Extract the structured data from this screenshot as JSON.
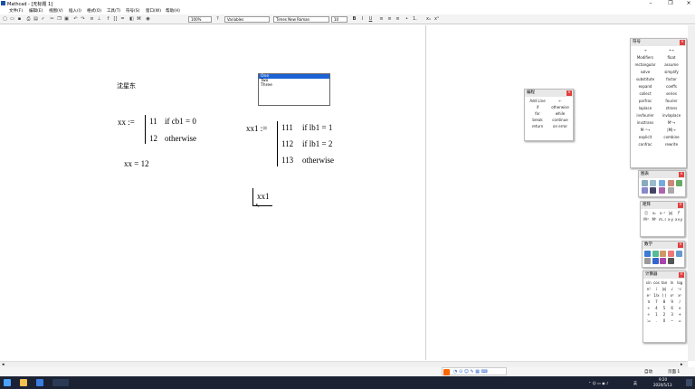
{
  "window": {
    "title": "Mathcad - [无标题 1]"
  },
  "menu": [
    "文件(F)",
    "编辑(E)",
    "视图(V)",
    "插入(I)",
    "格式(O)",
    "工具(T)",
    "符号(S)",
    "窗口(W)",
    "帮助(H)"
  ],
  "toolbar": {
    "zoom": "100%",
    "style": "Variables",
    "font": "Times New Roman",
    "size": "10",
    "bold": "B",
    "italic": "I",
    "underline": "U"
  },
  "worksheet": {
    "label_text": "沈星东",
    "xx_def": {
      "name": "xx :=",
      "row1_val": "11",
      "row1_cond": "if  cb1 = 0",
      "row2_val": "12",
      "row2_cond": "otherwise"
    },
    "xx_result": "xx = 12",
    "xx1_def": {
      "name": "xx1 :=",
      "row1_val": "111",
      "row1_cond": "if  lb1 = 1",
      "row2_val": "112",
      "row2_cond": "if  lb1 = 2",
      "row3_val": "113",
      "row3_cond": "otherwise"
    },
    "xx1_input": "xx1",
    "listbox": [
      "One",
      "Two",
      "Three"
    ]
  },
  "palettes": {
    "programming": {
      "title": "编程",
      "items": [
        "Add Line",
        "←",
        "if",
        "otherwise",
        "for",
        "while",
        "break",
        "continue",
        "return",
        "on error"
      ]
    },
    "symbolic": {
      "title": "符号",
      "items": [
        "→",
        "•→",
        "Modifiers",
        "float",
        "rectangular",
        "assume",
        "solve",
        "simplify",
        "substitute",
        "factor",
        "expand",
        "coeffs",
        "collect",
        "series",
        "parfrac",
        "fourier",
        "laplace",
        "ztrans",
        "invfourier",
        "invlaplace",
        "invztrans",
        "Mᵀ→",
        "M⁻¹→",
        "|M|→",
        "explicit",
        "combine",
        "confrac",
        "rewrite"
      ]
    },
    "graph": {
      "title": "图表"
    },
    "matrix": {
      "title": "矩阵"
    },
    "math": {
      "title": "数学"
    },
    "calculator": {
      "title": "计算器",
      "keys": [
        "sin",
        "cos",
        "tan",
        "ln",
        "log",
        "n!",
        "i",
        "|x|",
        "√",
        "ⁿ√",
        "eˣ",
        "1/x",
        "( )",
        "x²",
        "xʸ",
        "π",
        "7",
        "8",
        "9",
        "/",
        "÷",
        "4",
        "5",
        "6",
        "×",
        "÷",
        "1",
        "2",
        "3",
        "+",
        ":=",
        ".",
        "0",
        "−",
        "="
      ]
    }
  },
  "statusbar": {
    "mode": "自动",
    "page": "页面 1"
  },
  "taskbar": {
    "time": "9:20",
    "date": "2020/5/13",
    "lang": "英"
  },
  "colors": {
    "accent": "#1e63d6",
    "taskbar": "#1b2233",
    "close": "#e04040"
  }
}
